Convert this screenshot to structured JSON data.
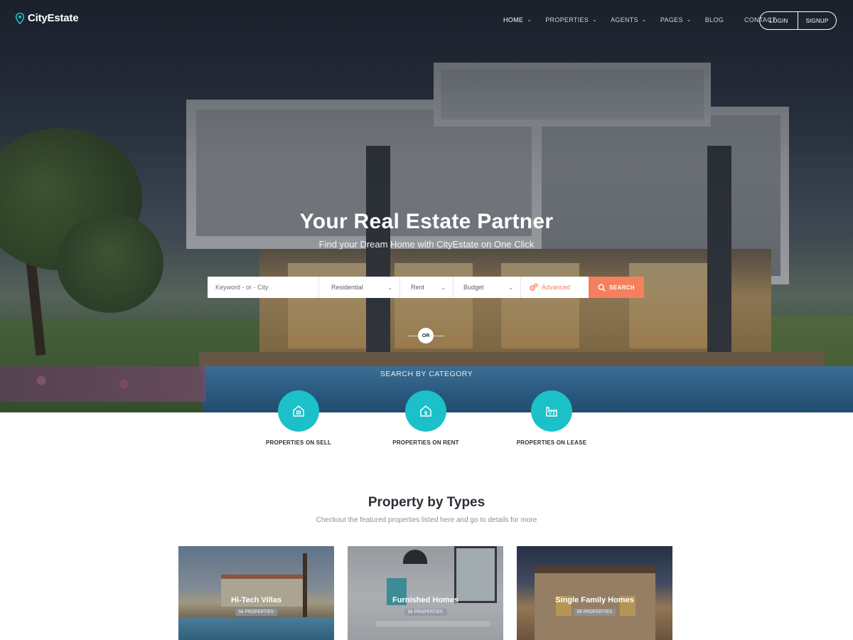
{
  "nav": {
    "brand": "CityEstate",
    "items": [
      {
        "label": "HOME",
        "dropdown": true,
        "active": true
      },
      {
        "label": "PROPERTIES",
        "dropdown": true,
        "active": false
      },
      {
        "label": "AGENTS",
        "dropdown": true,
        "active": false
      },
      {
        "label": "PAGES",
        "dropdown": true,
        "active": false
      },
      {
        "label": "BLOG",
        "dropdown": false,
        "active": false
      },
      {
        "label": "CONTACT",
        "dropdown": false,
        "active": false
      }
    ],
    "login_label": "LOGIN",
    "signup_label": "SIGNUP"
  },
  "hero": {
    "title": "Your Real Estate Partner",
    "subtitle": "Find your Dream Home with CityEstate on One Click"
  },
  "search": {
    "keyword_placeholder": "Keyword - or - City",
    "type_value": "Residential",
    "mode_value": "Rent",
    "budget_value": "Budget",
    "advanced_label": "Advanced",
    "search_label": "SEARCH"
  },
  "divider": {
    "or_label": "OR"
  },
  "categories": {
    "heading": "SEARCH BY CATEGORY",
    "items": [
      {
        "label": "PROPERTIES ON SELL",
        "icon": "house-icon"
      },
      {
        "label": "PROPERTIES ON RENT",
        "icon": "dollar-house-icon"
      },
      {
        "label": "PROPERTIES ON LEASE",
        "icon": "factory-icon"
      }
    ]
  },
  "types": {
    "title": "Property by Types",
    "subtitle": "Checkout the featured properties listed here and go to details for more",
    "cards": [
      {
        "title": "Hi-Tech Villas",
        "count": "56 PROPERTIES"
      },
      {
        "title": "Furnished Homes",
        "count": "56 PROPERTIES"
      },
      {
        "title": "Single Family Homes",
        "count": "56 PROPERTIES"
      }
    ]
  },
  "colors": {
    "accent_teal": "#1cc0c9",
    "accent_orange": "#f5805e",
    "heading": "#2b2f36"
  }
}
